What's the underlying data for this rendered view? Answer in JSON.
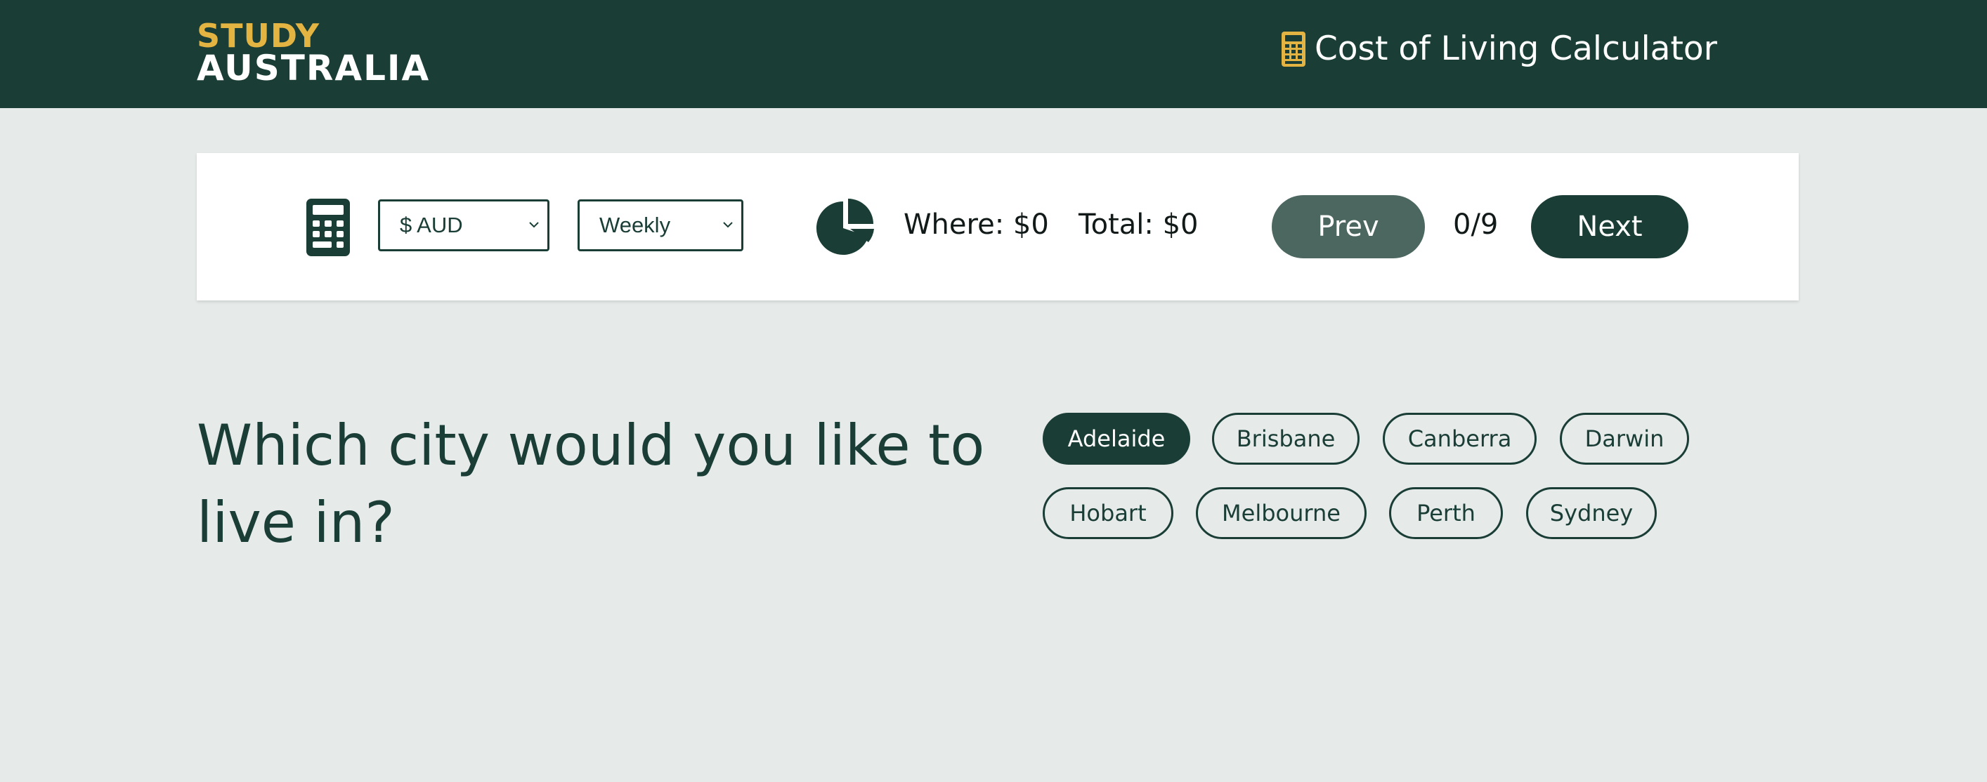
{
  "header": {
    "logo_line1": "STUDY",
    "logo_line2": "AUSTRALIA",
    "title": "Cost of Living Calculator",
    "icon": "calculator-icon"
  },
  "toolbar": {
    "icon": "calculator-icon",
    "currency": {
      "selected": "$ AUD"
    },
    "period": {
      "selected": "Weekly"
    },
    "pie_icon": "pie-chart-icon",
    "where_label": "Where: $0",
    "total_label": "Total: $0",
    "prev_label": "Prev",
    "next_label": "Next",
    "progress": "0/9"
  },
  "question": {
    "text": "Which city would you like to live in?"
  },
  "cities": [
    {
      "label": "Adelaide",
      "selected": true
    },
    {
      "label": "Brisbane",
      "selected": false
    },
    {
      "label": "Canberra",
      "selected": false
    },
    {
      "label": "Darwin",
      "selected": false
    },
    {
      "label": "Hobart",
      "selected": false
    },
    {
      "label": "Melbourne",
      "selected": false
    },
    {
      "label": "Perth",
      "selected": false
    },
    {
      "label": "Sydney",
      "selected": false
    }
  ],
  "colors": {
    "brand_dark": "#1a3d36",
    "brand_gold": "#e3b441",
    "background": "#e6ebea",
    "prev_button": "#4b675f"
  }
}
